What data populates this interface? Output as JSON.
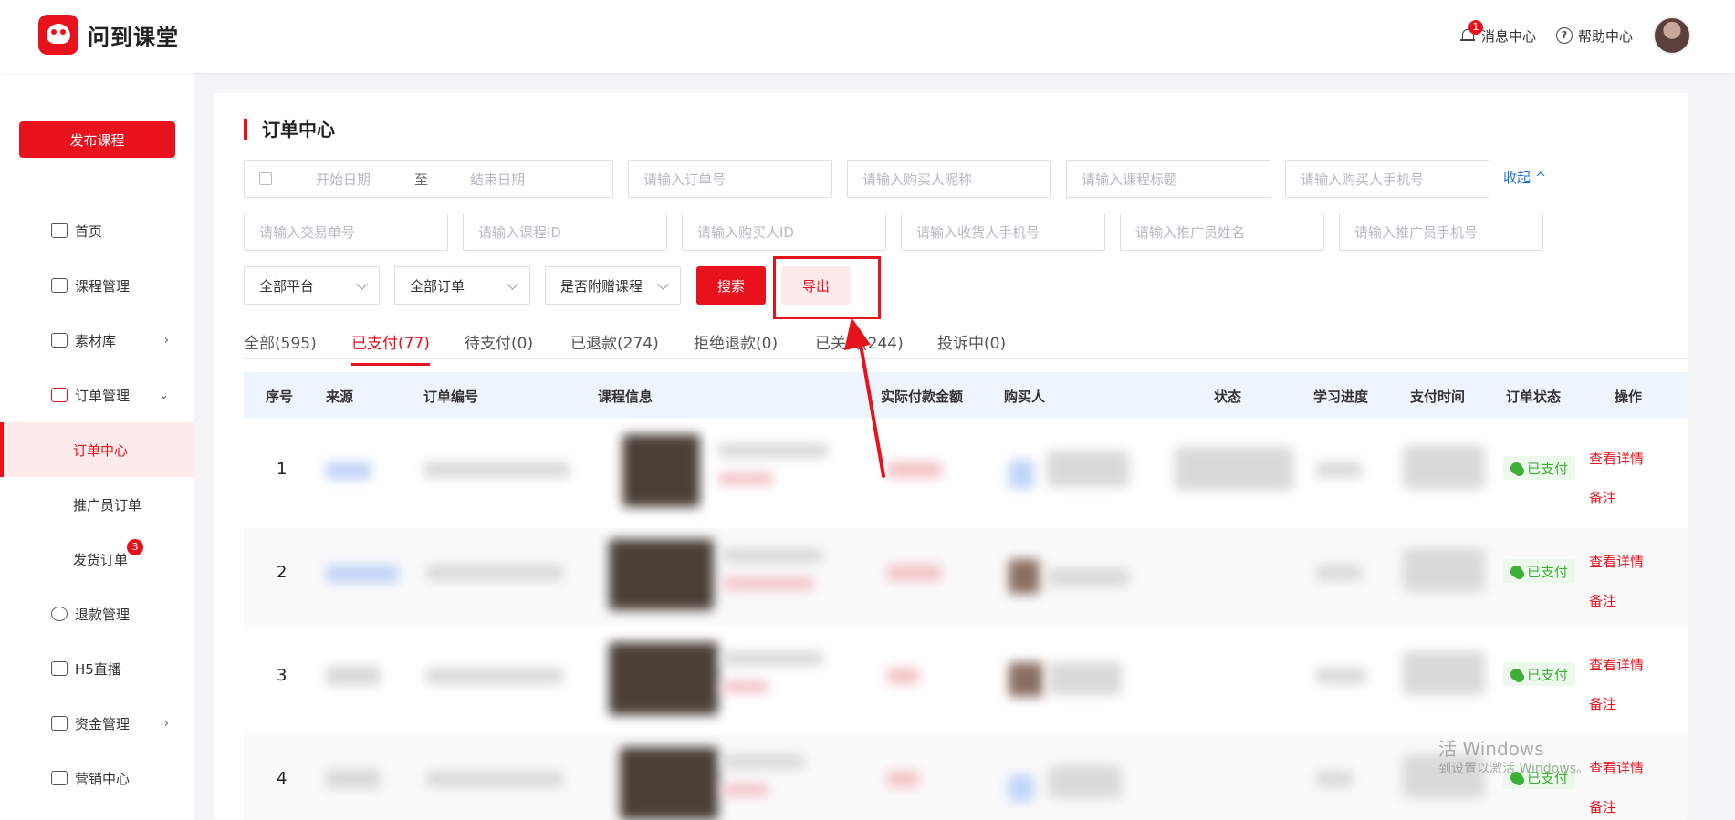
{
  "app": {
    "title": "问到课堂"
  },
  "header": {
    "messages_label": "消息中心",
    "messages_count": "1",
    "help_label": "帮助中心"
  },
  "sidebar": {
    "publish_label": "发布课程",
    "items": [
      {
        "label": "首页"
      },
      {
        "label": "课程管理"
      },
      {
        "label": "素材库",
        "arrow": "›"
      },
      {
        "label": "订单管理",
        "arrow": "⌄"
      },
      {
        "label": "订单中心"
      },
      {
        "label": "推广员订单"
      },
      {
        "label": "发货订单",
        "badge": "3"
      },
      {
        "label": "退款管理"
      },
      {
        "label": "H5直播"
      },
      {
        "label": "资金管理",
        "arrow": "›"
      },
      {
        "label": "营销中心"
      }
    ]
  },
  "page": {
    "title": "订单中心"
  },
  "filters": {
    "start_date": "开始日期",
    "to": "至",
    "end_date": "结束日期",
    "order_no": "请输入订单号",
    "buyer_nick": "请输入购买人昵称",
    "course_title": "请输入课程标题",
    "buyer_phone": "请输入购买人手机号",
    "collapse": "收起 ^",
    "trade_no": "请输入交易单号",
    "course_id": "请输入课程ID",
    "buyer_id": "请输入购买人ID",
    "receiver_phone": "请输入收货人手机号",
    "promoter_name": "请输入推广员姓名",
    "promoter_phone": "请输入推广员手机号",
    "platform": "全部平台",
    "order_type": "全部订单",
    "gift_course": "是否附赠课程",
    "search": "搜索",
    "export": "导出"
  },
  "tabs": [
    {
      "label": "全部(595)"
    },
    {
      "label": "已支付(77)",
      "active": true
    },
    {
      "label": "待支付(0)"
    },
    {
      "label": "已退款(274)"
    },
    {
      "label": "拒绝退款(0)"
    },
    {
      "label": "已关闭(244)"
    },
    {
      "label": "投诉中(0)"
    }
  ],
  "table": {
    "columns": [
      "序号",
      "来源",
      "订单编号",
      "课程信息",
      "实际付款金额",
      "购买人",
      "状态",
      "学习进度",
      "支付时间",
      "订单状态",
      "操作"
    ],
    "rows": [
      {
        "index": "1",
        "status": "已支付",
        "detail": "查看详情",
        "note": "备注"
      },
      {
        "index": "2",
        "status": "已支付",
        "detail": "查看详情",
        "note": "备注"
      },
      {
        "index": "3",
        "status": "已支付",
        "detail": "查看详情",
        "note": "备注"
      },
      {
        "index": "4",
        "status": "已支付",
        "detail": "查看详情",
        "note": "备注"
      }
    ]
  },
  "watermark": {
    "line1": "活 Windows",
    "line2": "到设置以激活 Windows。"
  },
  "colors": {
    "accent": "#e8121d",
    "success": "#3fae37",
    "link_blue": "#1f6fd6"
  }
}
